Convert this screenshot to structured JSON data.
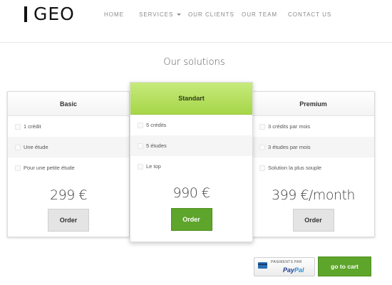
{
  "header": {
    "logo_text": "GEO",
    "nav": [
      {
        "label": "HOME"
      },
      {
        "label": "SERVICES"
      },
      {
        "label": "OUR CLIENTS"
      },
      {
        "label": "OUR TEAM"
      },
      {
        "label": "CONTACT US"
      }
    ]
  },
  "section_title": "Our solutions",
  "plans": {
    "basic": {
      "name": "Basic",
      "features": [
        "1 crédit",
        "Une étude",
        "Pour une petite étude"
      ],
      "price": "299 €",
      "order_label": "Order"
    },
    "standart": {
      "name": "Standart",
      "features": [
        "5 crédits",
        "5 études",
        "Le top"
      ],
      "price": "990 €",
      "order_label": "Order"
    },
    "premium": {
      "name": "Premium",
      "features": [
        "3 crédits par mois",
        "3 études par mois",
        "Solution la plus souple"
      ],
      "price": "399 €/month",
      "order_label": "Order"
    }
  },
  "checkout": {
    "paypal_small": "PAIEMENTS PAR",
    "paypal_pay": "Pay",
    "paypal_pal": "Pal",
    "cart_label": "go to cart"
  },
  "colors": {
    "accent_green": "#5ea52b",
    "featured_header": "#b3df5c"
  }
}
